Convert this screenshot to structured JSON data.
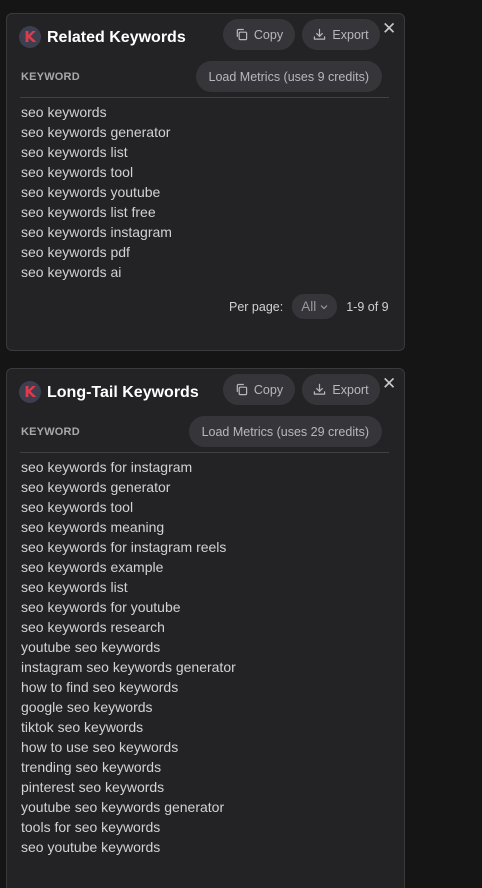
{
  "related": {
    "title": "Related Keywords",
    "logo_letter": "K",
    "copy_label": "Copy",
    "export_label": "Export",
    "close_glyph": "✕",
    "column_header": "KEYWORD",
    "metrics_label": "Load Metrics (uses 9 credits)",
    "keywords": [
      "seo keywords",
      "seo keywords generator",
      "seo keywords list",
      "seo keywords tool",
      "seo keywords youtube",
      "seo keywords list free",
      "seo keywords instagram",
      "seo keywords pdf",
      "seo keywords ai"
    ],
    "per_page_label": "Per page:",
    "per_page_value": "All",
    "range_text": "1-9 of 9"
  },
  "longtail": {
    "title": "Long-Tail Keywords",
    "logo_letter": "K",
    "copy_label": "Copy",
    "export_label": "Export",
    "close_glyph": "✕",
    "column_header": "KEYWORD",
    "metrics_label": "Load Metrics (uses 29 credits)",
    "keywords": [
      "seo keywords for instagram",
      "seo keywords generator",
      "seo keywords tool",
      "seo keywords meaning",
      "seo keywords for instagram reels",
      "seo keywords example",
      "seo keywords list",
      "seo keywords for youtube",
      "seo keywords research",
      "youtube seo keywords",
      "instagram seo keywords generator",
      "how to find seo keywords",
      "google seo keywords",
      "tiktok seo keywords",
      "how to use seo keywords",
      "trending seo keywords",
      "pinterest seo keywords",
      "youtube seo keywords generator",
      "tools for seo keywords",
      "seo youtube keywords"
    ]
  },
  "icons": {
    "copy": "copy-icon",
    "export": "download-icon",
    "close": "close-icon",
    "chevron": "chevron-down-icon"
  },
  "colors": {
    "page_bg": "#151515",
    "panel_bg": "#232325",
    "button_bg": "#36363a",
    "logo_bg": "#3d3f4f",
    "logo_letter": "#e03b4c",
    "text": "#d2d2d6"
  }
}
